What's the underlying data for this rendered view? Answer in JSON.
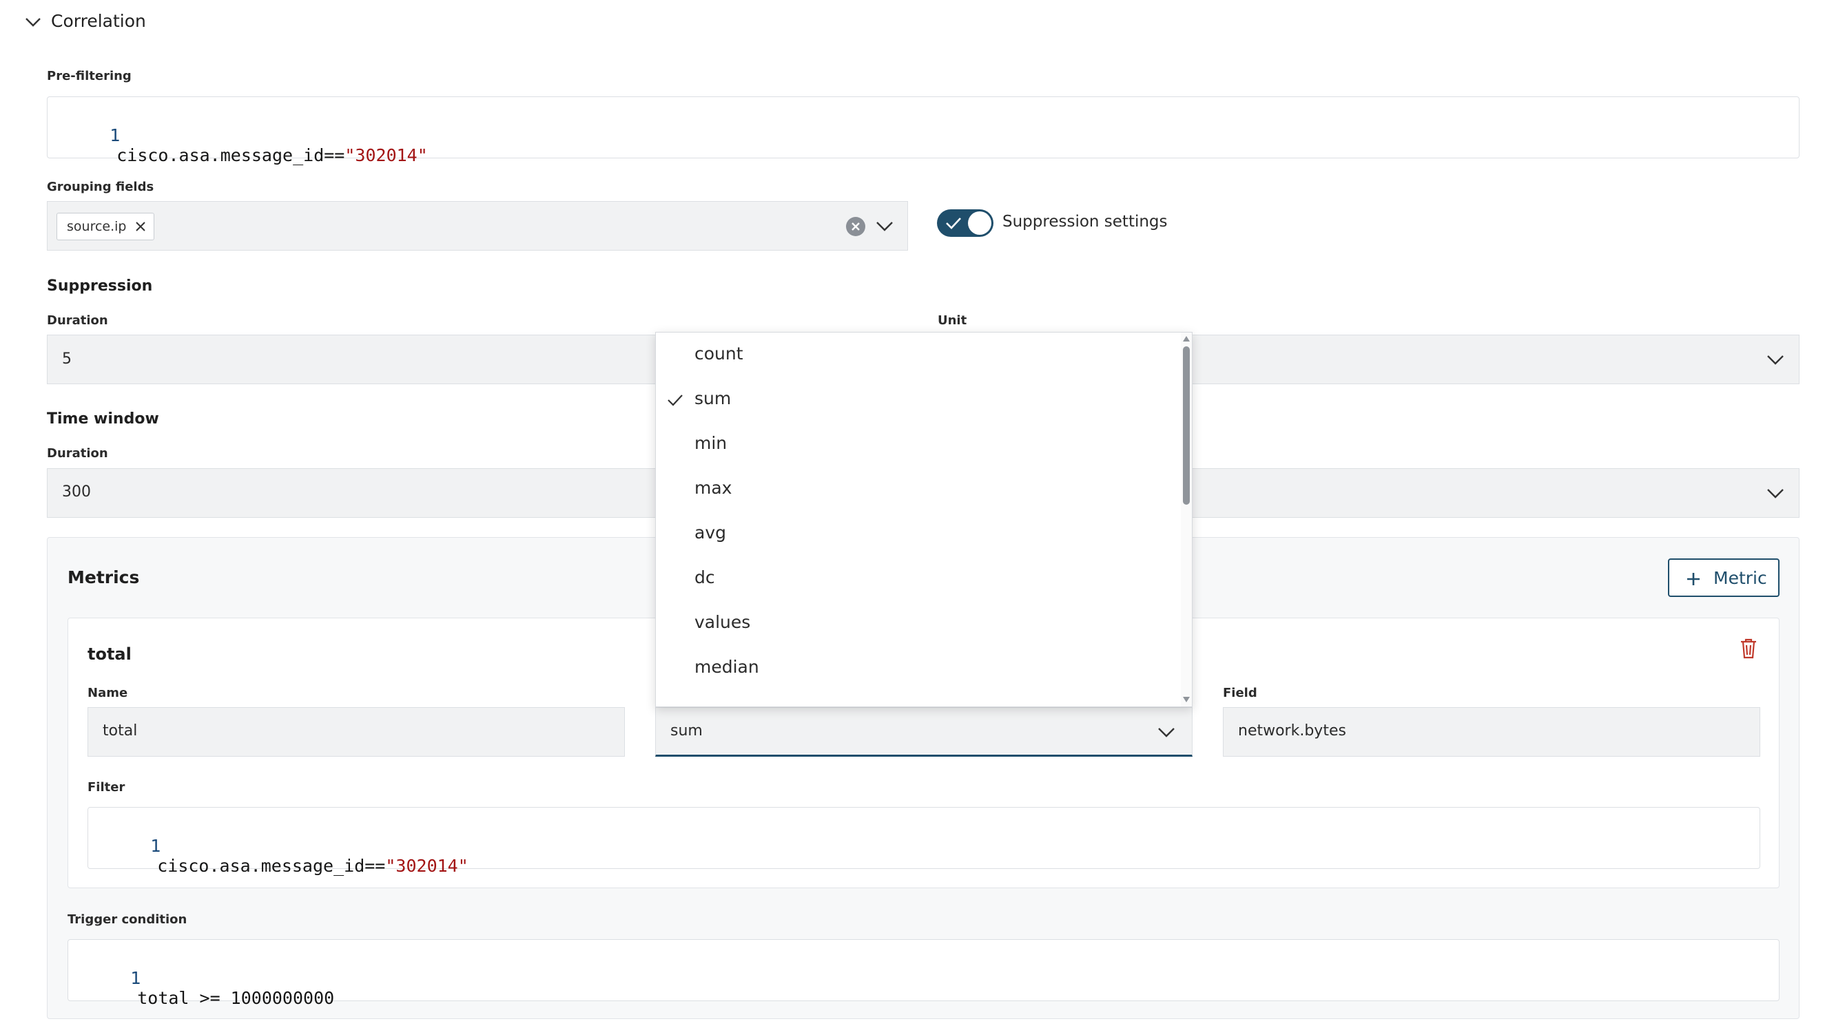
{
  "section": {
    "title": "Correlation"
  },
  "prefilter": {
    "label": "Pre-filtering",
    "line_number": "1",
    "code_prefix": "cisco.asa.message_id==",
    "code_string": "\"302014\""
  },
  "grouping": {
    "label": "Grouping fields",
    "tags": [
      "source.ip"
    ]
  },
  "suppression_toggle": {
    "label": "Suppression settings",
    "checked": true
  },
  "suppression": {
    "title": "Suppression",
    "duration_label": "Duration",
    "duration_value": "5",
    "unit_label": "Unit"
  },
  "time_window": {
    "title": "Time window",
    "duration_label": "Duration",
    "duration_value": "300"
  },
  "metrics": {
    "title": "Metrics",
    "add_button": "Metric",
    "card": {
      "title": "total",
      "name_label": "Name",
      "name_value": "total",
      "function_value": "sum",
      "field_label": "Field",
      "field_value": "network.bytes",
      "filter_label": "Filter",
      "filter_line_number": "1",
      "filter_code_prefix": "cisco.asa.message_id==",
      "filter_code_string": "\"302014\""
    }
  },
  "trigger": {
    "label": "Trigger condition",
    "line_number": "1",
    "code": "total >= 1000000000"
  },
  "dropdown": {
    "selected": "sum",
    "options": [
      "count",
      "sum",
      "min",
      "max",
      "avg",
      "dc",
      "values",
      "median"
    ]
  },
  "colors": {
    "accent": "#1f4e6b",
    "delete": "#c0392b",
    "string": "#a31515"
  }
}
